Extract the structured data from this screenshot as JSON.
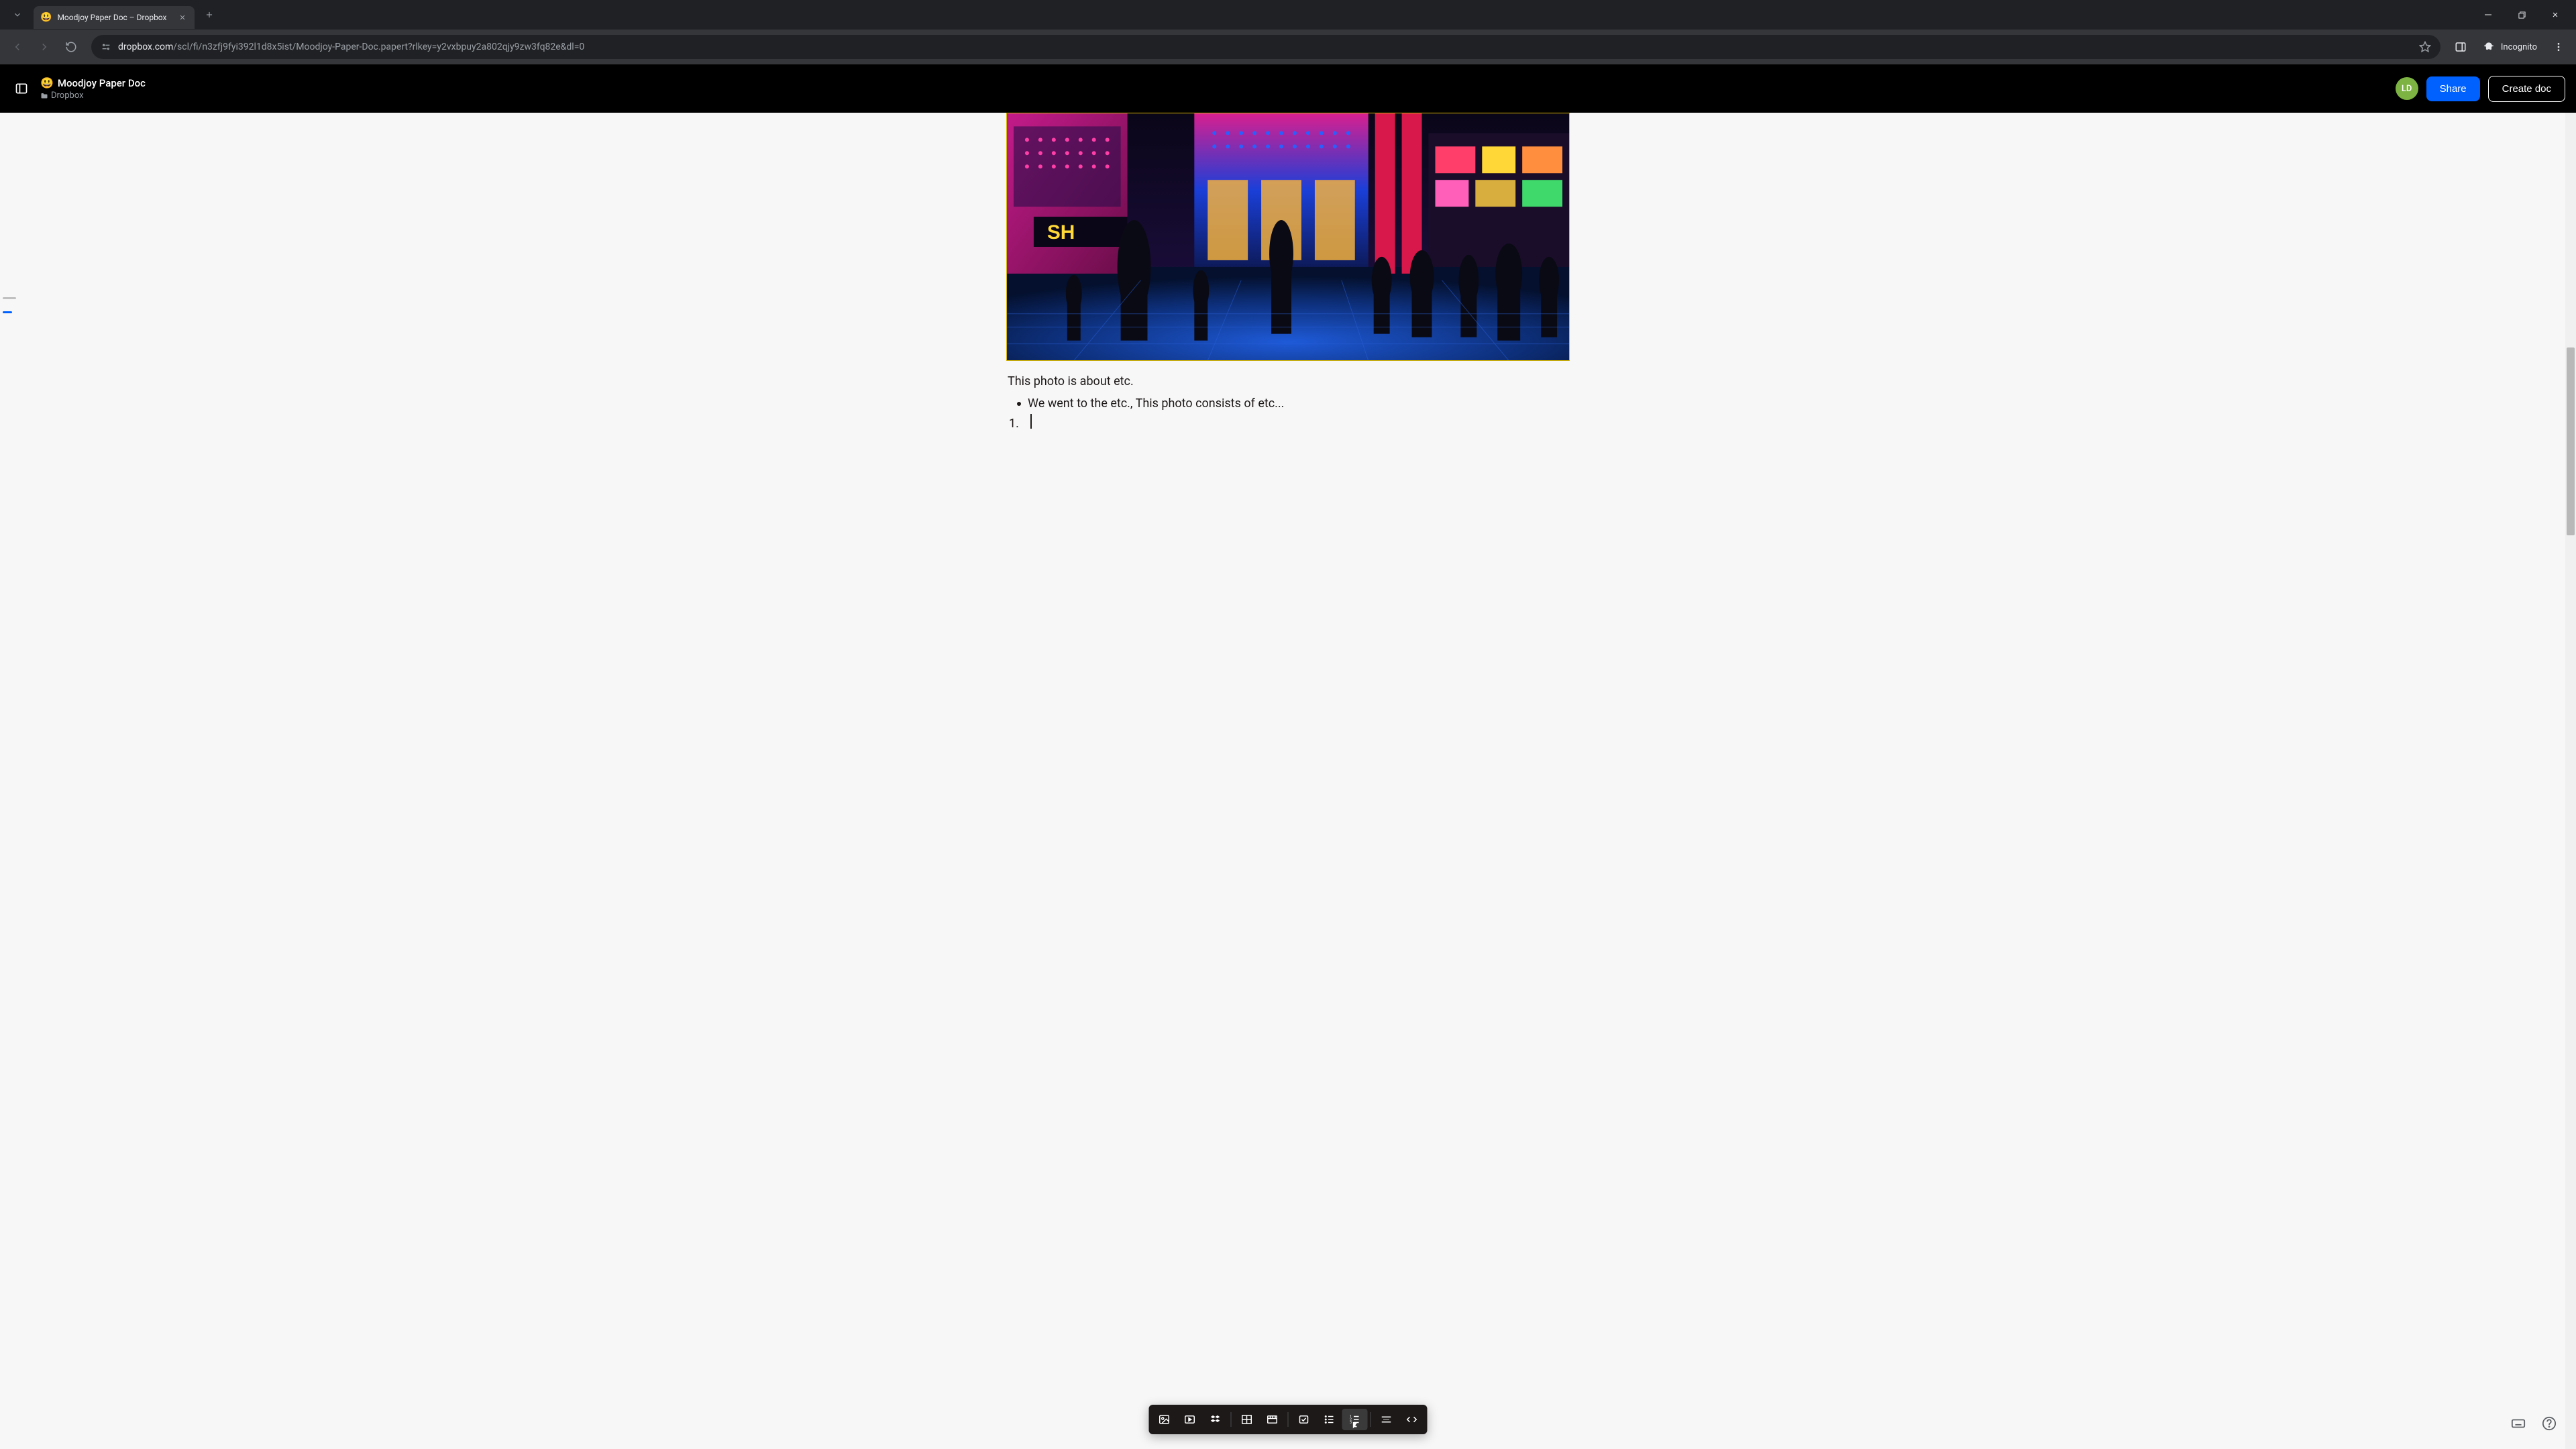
{
  "browser": {
    "tab_title": "Moodjoy Paper Doc – Dropbox",
    "url_domain": "dropbox.com",
    "url_path": "/scl/fi/n3zfj9fyi392l1d8x5ist/Moodjoy-Paper-Doc.papert?rlkey=y2vxbpuy2a802qjy9zw3fq82e&dl=0",
    "incognito_label": "Incognito"
  },
  "header": {
    "doc_emoji": "😃",
    "doc_title": "Moodjoy Paper Doc",
    "breadcrumb": "Dropbox",
    "avatar_initials": "LD",
    "share_label": "Share",
    "create_label": "Create doc"
  },
  "content": {
    "paragraph": "This photo is about etc.",
    "bullet_text": "We went to the etc., This photo consists of etc...",
    "number_marker": "1."
  },
  "format_toolbar": {
    "items": [
      "image",
      "video",
      "dropbox",
      "table",
      "timeline",
      "checklist",
      "bulleted-list",
      "numbered-list",
      "divider",
      "code"
    ]
  }
}
